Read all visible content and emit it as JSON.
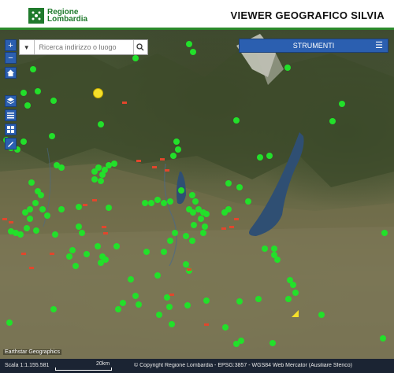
{
  "header": {
    "logo_line1": "Regione",
    "logo_line2": "Lombardia",
    "title": "VIEWER GEOGRAFICO SILVIA"
  },
  "search": {
    "placeholder": "Ricerca indirizzo o luogo"
  },
  "toolbar": {
    "zoom_in": "+",
    "zoom_out": "−"
  },
  "tools_panel": {
    "label": "STRUMENTI"
  },
  "map": {
    "basemap_attribution": "Earthstar Geographics",
    "point_color": "#22e02a",
    "area_color": "#e2462c",
    "highlight_color": "#f5e02a"
  },
  "footer": {
    "scale": "Scala 1:1.155.581",
    "scale_distance": "20km",
    "info": "© Copyright Regione Lombardia - EPSG:3857 - WGS84 Web Mercator (Ausiliare Sferico)"
  }
}
